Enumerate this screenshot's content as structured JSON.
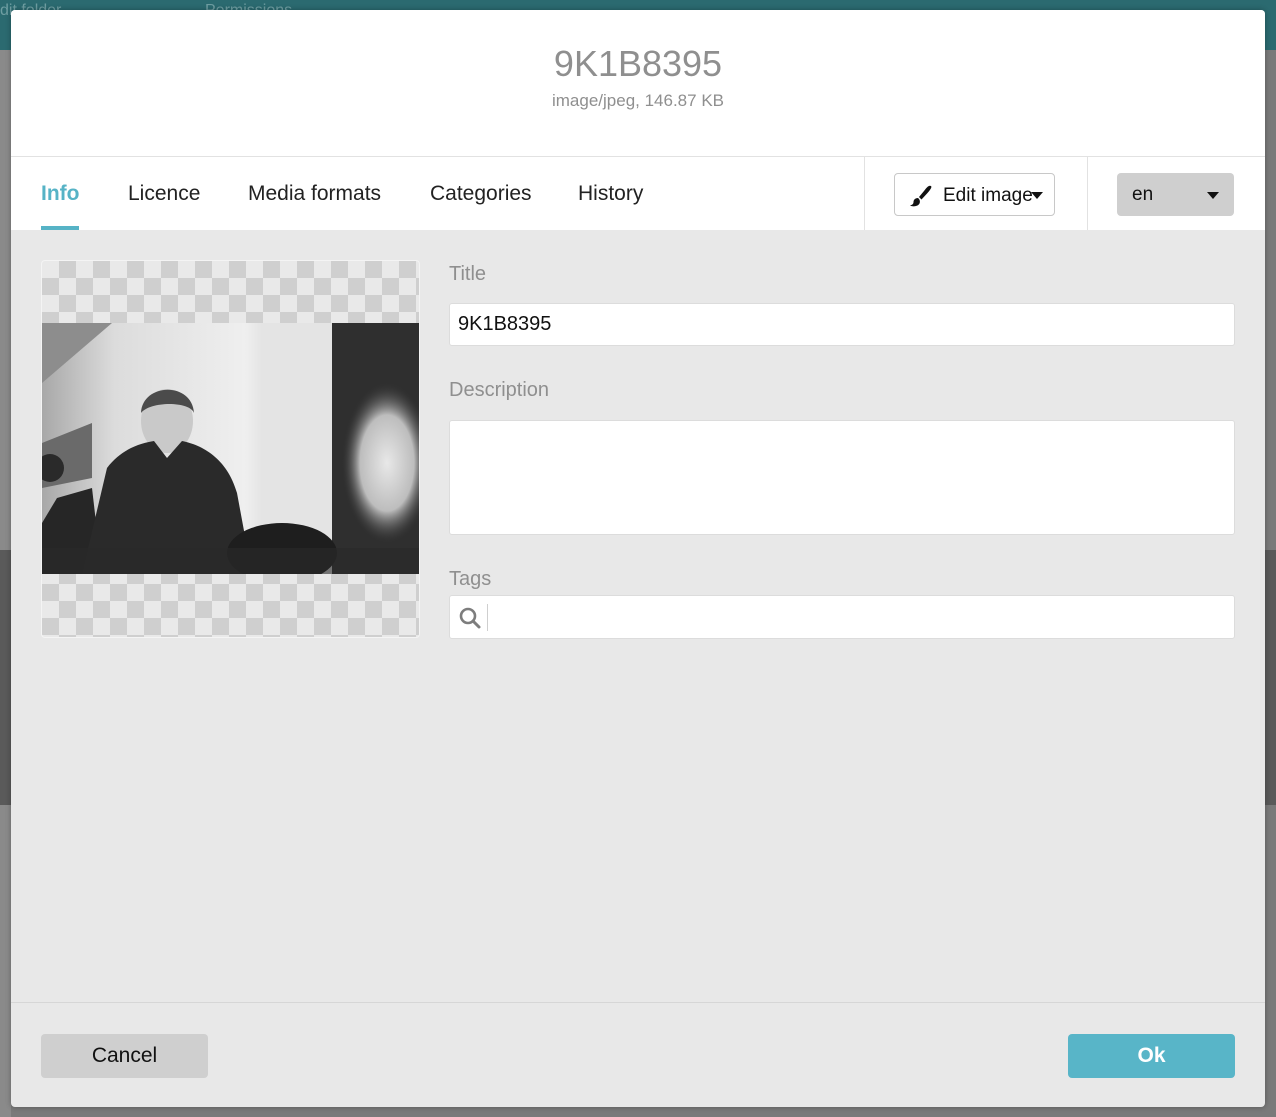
{
  "background": {
    "topbar_items": [
      "dit folder",
      "Permissions"
    ]
  },
  "modal": {
    "title": "9K1B8395",
    "subtitle": "image/jpeg, 146.87 KB",
    "tabs": [
      {
        "label": "Info",
        "active": true
      },
      {
        "label": "Licence",
        "active": false
      },
      {
        "label": "Media formats",
        "active": false
      },
      {
        "label": "Categories",
        "active": false
      },
      {
        "label": "History",
        "active": false
      }
    ],
    "edit_image_button": {
      "label": "Edit image",
      "icon": "paint-brush-icon"
    },
    "language_select": {
      "selected": "en"
    },
    "preview": {
      "alt": "Black and white photo of a smiling man in a dark sweater"
    },
    "fields": {
      "title": {
        "label": "Title",
        "value": "9K1B8395"
      },
      "description": {
        "label": "Description",
        "value": ""
      },
      "tags": {
        "label": "Tags",
        "value": "",
        "icon": "search-icon"
      }
    },
    "footer": {
      "cancel_label": "Cancel",
      "ok_label": "Ok"
    }
  },
  "colors": {
    "accent": "#56b3c6",
    "ok_button": "#58b5c8",
    "cancel_button": "#cfcfcf",
    "body_background": "#e8e8e8",
    "backdrop_topbar": "#2b6a70"
  }
}
